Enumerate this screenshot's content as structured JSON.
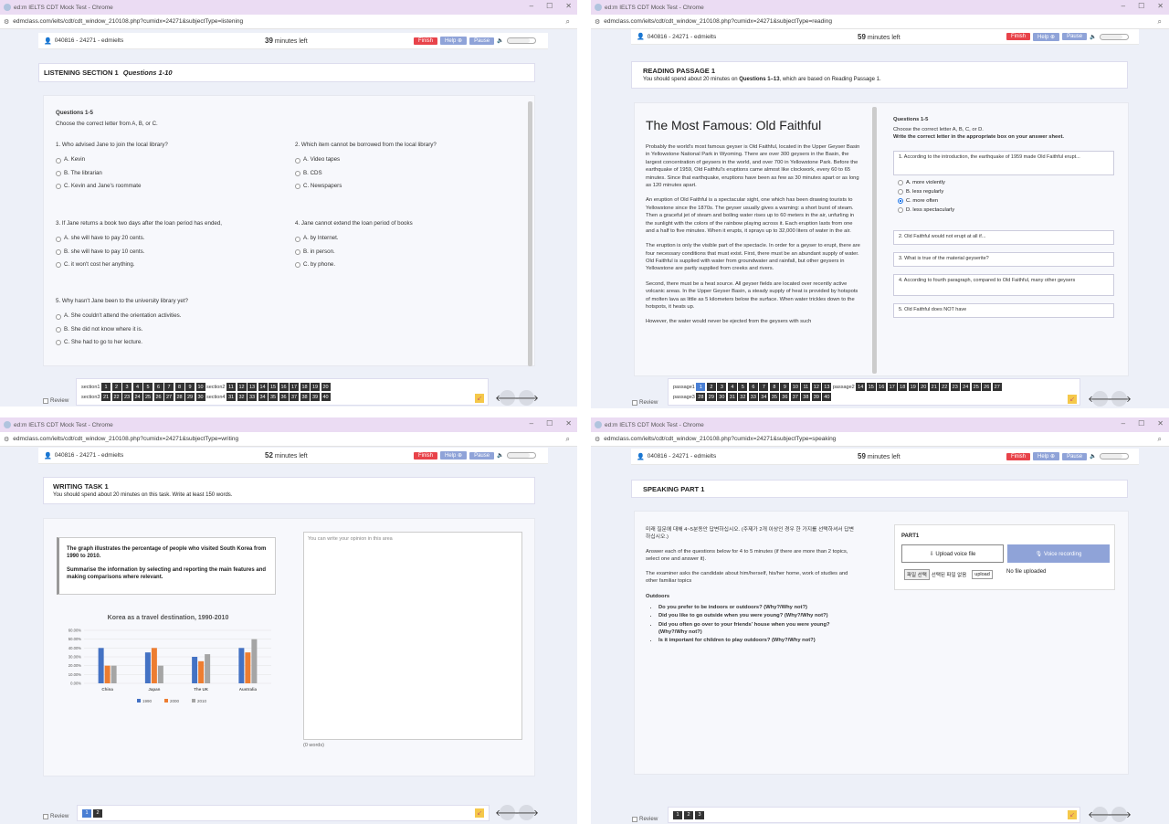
{
  "listening": {
    "tab_title": "ed:m IELTS CDT Mock Test - Chrome",
    "url": "edmclass.com/ielts/cdt/cdt_window_210108.php?cumidx=24271&subjectType=listening",
    "user": "040816 - 24271 - edmielts",
    "timer_value": "39",
    "timer_unit": "minutes left",
    "finish": "Finish",
    "help": "Help ⊕",
    "pause": "Pause",
    "section_label": "LISTENING SECTION 1",
    "section_questions": "Questions 1-10",
    "q_range": "Questions 1-5",
    "q_instr": "Choose the correct letter from A, B, or C.",
    "questions": [
      {
        "n": "1.",
        "text": "Who advised Jane to join the local library?",
        "opts": [
          "A. Kevin",
          "B. The librarian",
          "C. Kevin and Jane's roommate"
        ]
      },
      {
        "n": "2.",
        "text": "Which item cannot be borrowed from the local library?",
        "opts": [
          "A. Video tapes",
          "B. CDS",
          "C. Newspapers"
        ]
      },
      {
        "n": "3.",
        "text": "If Jane returns a book two days after the loan period has ended,",
        "opts": [
          "A. she will have to pay 20 cents.",
          "B. she will have to pay 10 cents.",
          "C. it won't cost her anything."
        ]
      },
      {
        "n": "4.",
        "text": "Jane cannot extend the loan period of books",
        "opts": [
          "A. by Internet.",
          "B. in person.",
          "C. by phone."
        ]
      },
      {
        "n": "5.",
        "text": "Why hasn't Jane been to the university library yet?",
        "opts": [
          "A. She couldn't attend the orientation activities.",
          "B. She did not know where it is.",
          "C. She had to go to her lecture."
        ]
      }
    ],
    "nav_rows": [
      {
        "labels": [
          "section1",
          "section2"
        ],
        "ranges": [
          [
            1,
            10
          ],
          [
            11,
            20
          ]
        ]
      },
      {
        "labels": [
          "section3",
          "section4"
        ],
        "ranges": [
          [
            21,
            30
          ],
          [
            31,
            40
          ]
        ]
      }
    ],
    "review": "Review"
  },
  "reading": {
    "tab_title": "ed:m IELTS CDT Mock Test - Chrome",
    "url": "edmclass.com/ielts/cdt/cdt_window_210108.php?cumidx=24271&subjectType=reading",
    "user": "040816 - 24271 - edmielts",
    "timer_value": "59",
    "timer_unit": "minutes left",
    "finish": "Finish",
    "help": "Help ⊕",
    "pause": "Pause",
    "passage_label": "READING PASSAGE 1",
    "passage_instr_pre": "You should spend about 20 minutes on ",
    "passage_instr_bold": "Questions 1–13",
    "passage_instr_post": ", which are based on Reading Passage 1.",
    "title": "The Most Famous: Old Faithful",
    "paragraphs": [
      "Probably the world's most famous geyser is Old Faithful, located in the Upper Geyser Basin in Yellowstone National Park in Wyoming. There are over 300 geysers in the Basin, the largest concentration of geysers in the world, and over 700 in Yellowstone Park. Before the earthquake of 1959, Old Faithful's eruptions came almost like clockwork, every 60 to 65 minutes. Since that earthquake, eruptions have been as few as 30 minutes apart or as long as 120 minutes apart.",
      "An eruption of Old Faithful is a spectacular sight, one which has been drawing tourists to Yellowstone since the 1870s. The geyser usually gives a warning: a short burst of steam. Then a graceful jet of steam and boiling water rises up to 60 meters in the air, unfurling in the sunlight with the colors of the rainbow playing across it. Each eruption lasts from one and a half to five minutes. When it erupts, it sprays up to 32,000 liters of water in the air.",
      "The eruption is only the visible part of the spectacle. In order for a geyser to erupt, there are four necessary conditions that must exist. First, there must be an abundant supply of water. Old Faithful is supplied with water from groundwater and rainfall, but other geysers in Yellowstone are partly supplied from creeks and rivers.",
      "Second, there must be a heat source. All geyser fields are located over recently active volcanic areas. In the Upper Geyser Basin, a steady supply of heat is provided by hotspots of molten lava as little as 5 kilometers below the surface. When water trickles down to the hotspots, it heats up.",
      "However, the water would never be ejected from the geysers with such"
    ],
    "q_range": "Questions 1-5",
    "q_instr1": "Choose the correct letter A, B, C, or D.",
    "q_instr2": "Write the correct letter in the appropriate box on your answer sheet.",
    "q1": "1. According to the introduction, the earthquake of 1959 made Old Faithful erupt...",
    "q1_opts": [
      "A. more violently",
      "B. less regularly",
      "C. more often",
      "D. less spectacularly"
    ],
    "q1_selected": 2,
    "qs": [
      "2. Old Faithful would not erupt at all if...",
      "3. What is true of the material geyserite?",
      "4. According to fourth paragraph, compared to Old Faithful, many other geysers",
      "5. Old Faithful does NOT have"
    ],
    "nav_rows": [
      {
        "labels": [
          "passage1",
          "passage2"
        ],
        "ranges": [
          [
            1,
            13
          ],
          [
            14,
            27
          ]
        ]
      },
      {
        "labels": [
          "passage3"
        ],
        "ranges": [
          [
            28,
            40
          ]
        ]
      }
    ],
    "review": "Review"
  },
  "writing": {
    "tab_title": "ed:m IELTS CDT Mock Test - Chrome",
    "url": "edmclass.com/ielts/cdt/cdt_window_210108.php?cumidx=24271&subjectType=writing",
    "user": "040816 - 24271 - edmielts",
    "timer_value": "52",
    "timer_unit": "minutes left",
    "finish": "Finish",
    "help": "Help ⊕",
    "pause": "Pause",
    "task_label": "WRITING TASK 1",
    "task_instr": "You should spend about 20 minutes on this task. Write at least 150 words.",
    "prompt1": "The graph illustrates the percentage of people who visited South Korea from 1990 to 2010.",
    "prompt2": "Summarise the information by selecting and reporting the main features and making comparisons where relevant.",
    "textarea_placeholder": "You can write your opinion in this area",
    "word_count": "(0 words)",
    "pages": [
      "1",
      "2"
    ],
    "review": "Review"
  },
  "speaking": {
    "tab_title": "ed:m IELTS CDT Mock Test - Chrome",
    "url": "edmclass.com/ielts/cdt/cdt_window_210108.php?cumidx=24271&subjectType=speaking",
    "user": "040816 - 24271 - edmielts",
    "timer_value": "59",
    "timer_unit": "minutes left",
    "finish": "Finish",
    "help": "Help ⊕",
    "pause": "Pause",
    "part_label": "SPEAKING PART 1",
    "korean_instr": "미래 질문에 대해 4~5분동안 답변하십시오. (주제가 2개 이상인 경우 한 가지를 선택하셔서 답변하십시오.)",
    "eng_instr": "Answer each of the questions below for 4 to 5 minutes (if there are more than 2 topics, select one and answer it).",
    "examiner": "The examiner asks the candidate about him/herself, his/her home, work of studies and other familiar topics",
    "topic": "Outdoors",
    "items": [
      "Do you prefer to be indoors or outdoors? (Why?/Why not?)",
      "Did you like to go outside when you were young? (Why?/Why not?)",
      "Did you often go over to your friends' house when you were young? (Why?/Why not?)",
      "Is it important for children to play outdoors? (Why?/Why not?)"
    ],
    "part_box_label": "PART1",
    "upload_tab": "⇩ Upload voice file",
    "record_tab": "🎙 Voice recording",
    "file_btn": "파일 선택",
    "file_none": "선택된 파일 없음",
    "upload_btn": "upload",
    "no_file": "No file uploaded",
    "pages": [
      "1",
      "2",
      "3"
    ],
    "review": "Review"
  },
  "chart_data": {
    "type": "bar",
    "title": "Korea as a travel destination, 1990-2010",
    "categories": [
      "China",
      "Japan",
      "The UK",
      "Australia"
    ],
    "series": [
      {
        "name": "1990",
        "values": [
          40,
          35,
          30,
          40
        ],
        "color": "#4472c4"
      },
      {
        "name": "2000",
        "values": [
          20,
          40,
          25,
          35
        ],
        "color": "#ed7d31"
      },
      {
        "name": "2010",
        "values": [
          20,
          20,
          33,
          50
        ],
        "color": "#a5a5a5"
      }
    ],
    "ylim": [
      0,
      60
    ],
    "yticks": [
      "0.00%",
      "10.00%",
      "20.00%",
      "30.00%",
      "40.00%",
      "50.00%",
      "60.00%"
    ],
    "legend": "bottom"
  }
}
